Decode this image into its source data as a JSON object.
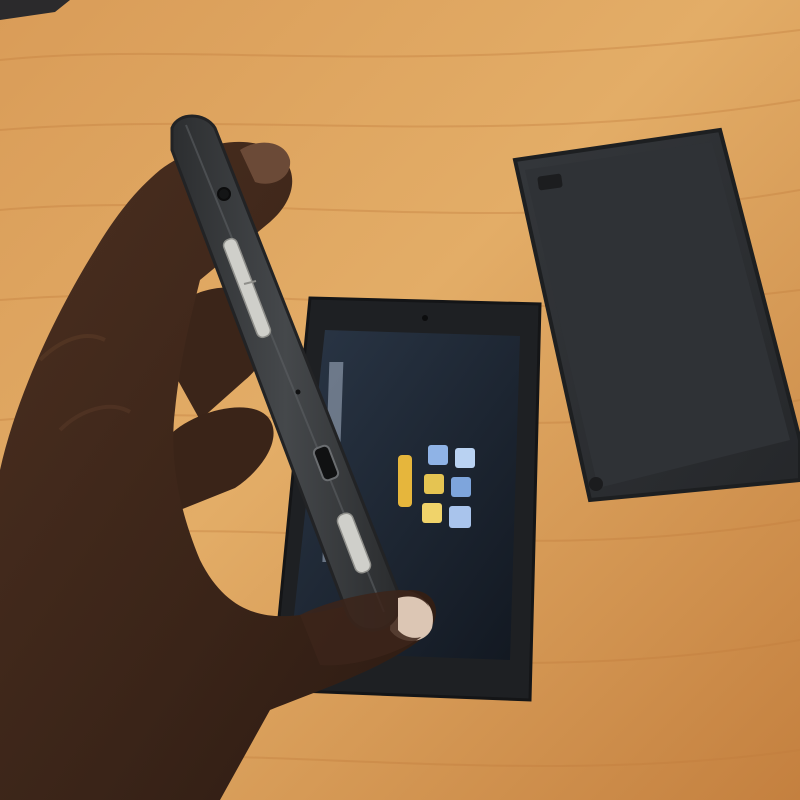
{
  "scene": {
    "description_colors": {
      "wood_light": "#e0a861",
      "wood_mid": "#cf8f48",
      "wood_dark": "#b8753a",
      "device_body": "#3a3c3e",
      "device_edge": "#2a2b2d",
      "case_body": "#2e3033",
      "screen_bg": "#1a2230",
      "skin_dark": "#3a2418",
      "skin_mid": "#4a2f20",
      "button_silver": "#c9c9c4"
    },
    "screen_icon_colors": [
      "#8fb3e6",
      "#b9d2f2",
      "#e5c452",
      "#f0d36a",
      "#7ea5dc",
      "#a9c4ec",
      "#e2b84a",
      "#f2c6a0"
    ]
  }
}
